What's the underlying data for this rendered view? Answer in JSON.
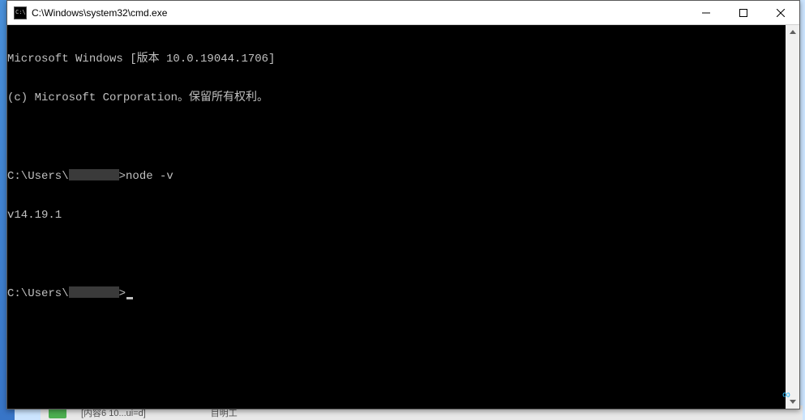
{
  "window": {
    "title": "C:\\Windows\\system32\\cmd.exe"
  },
  "terminal": {
    "line1": "Microsoft Windows [版本 10.0.19044.1706]",
    "line2": "(c) Microsoft Corporation。保留所有权利。",
    "prompt1_pre": "C:\\Users\\",
    "prompt1_post": ">node -v",
    "output1": "v14.19.1",
    "prompt2_pre": "C:\\Users\\",
    "prompt2_post": ">"
  },
  "taskbar": {
    "item1": "[内容6 10...ui=d]",
    "item2": "目明工"
  }
}
